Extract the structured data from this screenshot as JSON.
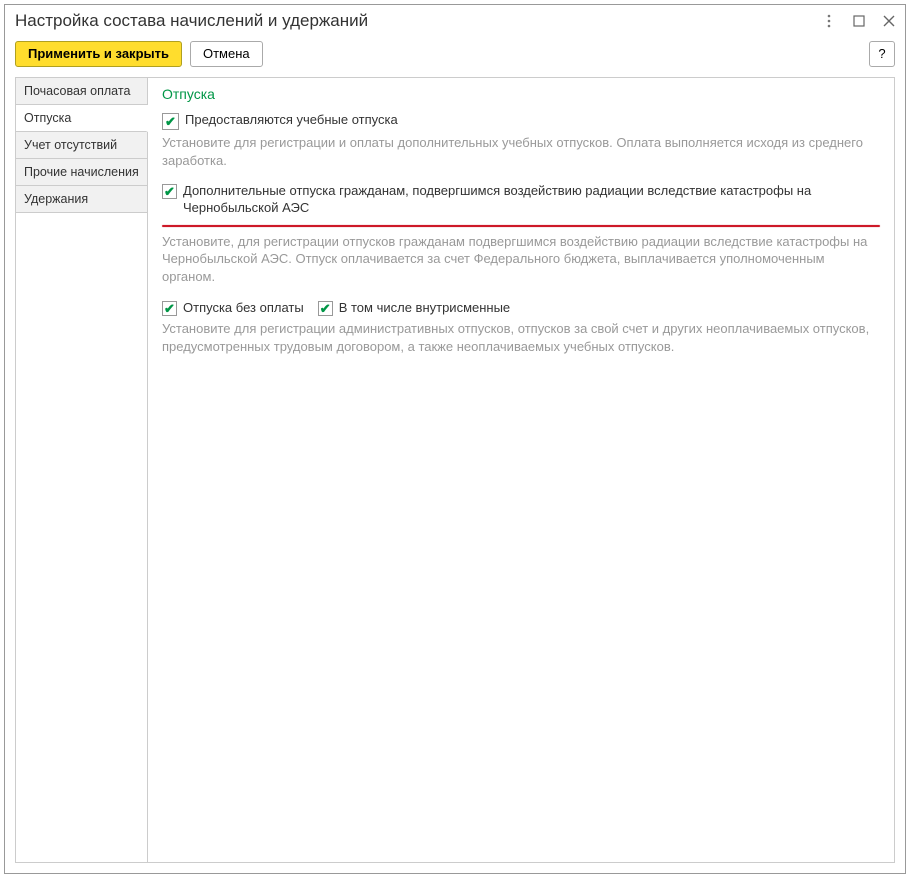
{
  "title": "Настройка состава начислений и удержаний",
  "toolbar": {
    "apply_close": "Применить и закрыть",
    "cancel": "Отмена",
    "help": "?"
  },
  "tabs": [
    {
      "label": "Почасовая оплата",
      "active": false
    },
    {
      "label": "Отпуска",
      "active": true
    },
    {
      "label": "Учет отсутствий",
      "active": false
    },
    {
      "label": "Прочие начисления",
      "active": false
    },
    {
      "label": "Удержания",
      "active": false
    }
  ],
  "section": {
    "title": "Отпуска",
    "opt1_label": "Предоставляются учебные отпуска",
    "opt1_hint": "Установите для регистрации и оплаты дополнительных учебных отпусков. Оплата выполняется исходя из среднего заработка.",
    "opt2_label": "Дополнительные отпуска гражданам, подвергшимся воздействию радиации вследствие катастрофы на Чернобыльской АЭС",
    "opt2_hint": "Установите, для регистрации отпусков гражданам подвергшимся воздействию радиации вследствие катастрофы на Чернобыльской АЭС. Отпуск оплачивается за счет Федерального бюджета, выплачивается уполномоченным органом.",
    "opt3_label": "Отпуска без оплаты",
    "opt4_label": "В том числе внутрисменные",
    "opt3_hint": "Установите для регистрации административных отпусков, отпусков за свой счет и других неоплачиваемых отпусков, предусмотренных трудовым договором, а также неоплачиваемых учебных отпусков."
  }
}
